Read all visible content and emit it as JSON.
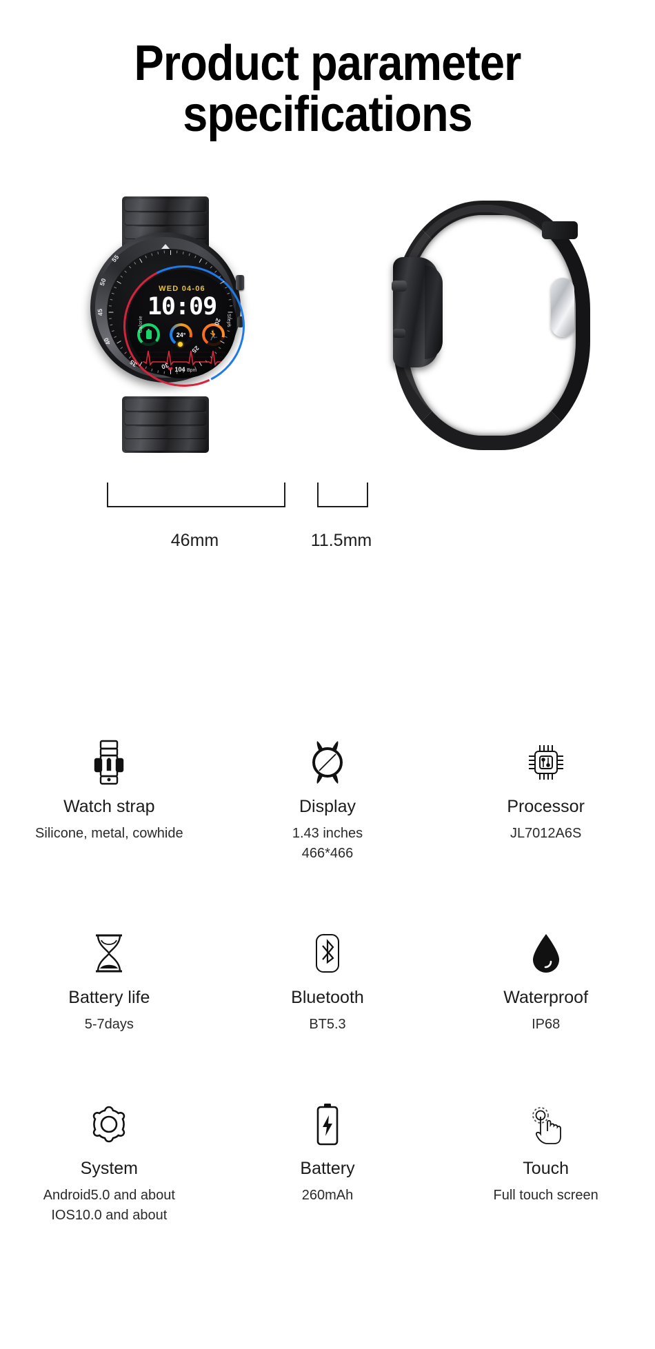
{
  "title": {
    "line1": "Product parameter specifications",
    "line1_part1": "Product parameter",
    "line1_part2": "specifications"
  },
  "product_images": {
    "front_view_alt": "smartwatch-front-view",
    "side_view_alt": "smartwatch-side-profile-view",
    "watch_face": {
      "date": "WED  04-06",
      "time": "10:09",
      "battery_label": "Calorie",
      "steps_label": "Steps",
      "temperature": "24°",
      "heart_rate": "104",
      "heart_rate_unit": "Bpm",
      "bezel_numbers": [
        "55",
        "50",
        "45",
        "40",
        "35",
        "30",
        "25",
        "20"
      ]
    }
  },
  "dimensions": {
    "width_label": "46mm",
    "thickness_label": "11.5mm"
  },
  "specs": [
    {
      "icon": "watch-strap-icon",
      "title": "Watch strap",
      "value": "Silicone, metal, cowhide",
      "value2": ""
    },
    {
      "icon": "watch-display-icon",
      "title": "Display",
      "value": "1.43 inches",
      "value2": "466*466"
    },
    {
      "icon": "processor-chip-icon",
      "title": "Processor",
      "value": "JL7012A6S",
      "value2": ""
    },
    {
      "icon": "hourglass-icon",
      "title": "Battery life",
      "value": "5-7days",
      "value2": ""
    },
    {
      "icon": "bluetooth-icon",
      "title": "Bluetooth",
      "value": "BT5.3",
      "value2": ""
    },
    {
      "icon": "water-drop-icon",
      "title": "Waterproof",
      "value": "IP68",
      "value2": ""
    },
    {
      "icon": "gear-icon",
      "title": "System",
      "value": "Android5.0 and about",
      "value2": "IOS10.0 and about"
    },
    {
      "icon": "battery-icon",
      "title": "Battery",
      "value": "260mAh",
      "value2": ""
    },
    {
      "icon": "touch-hand-icon",
      "title": "Touch",
      "value": "Full touch screen",
      "value2": ""
    }
  ],
  "colors": {
    "background": "#ffffff",
    "text": "#1b1b1b",
    "accent_yellow": "#e8c13c",
    "accent_green": "#19d36b",
    "accent_orange": "#f4641c",
    "accent_blue": "#1b7ff0",
    "accent_red": "#e8273c"
  }
}
